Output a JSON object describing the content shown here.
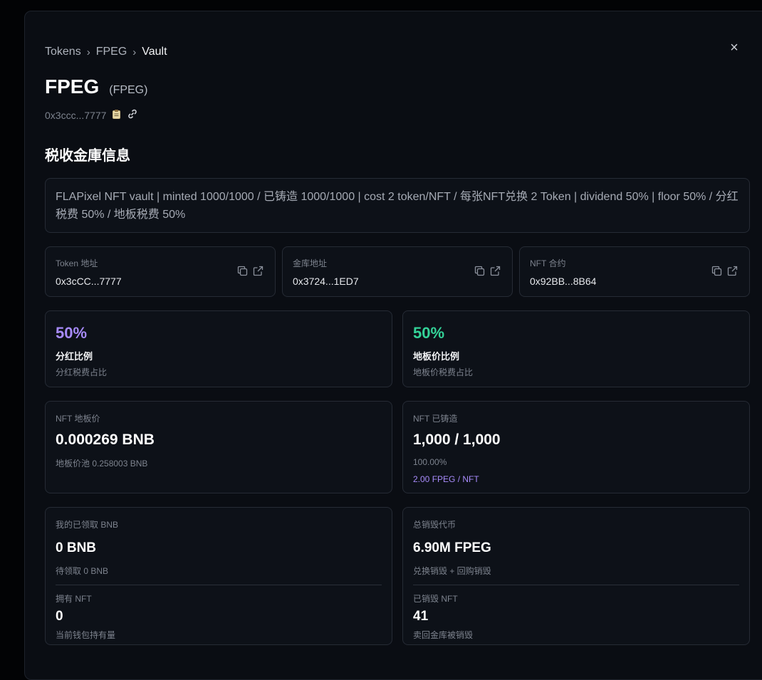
{
  "breadcrumb": [
    "Tokens",
    "FPEG",
    "Vault"
  ],
  "breadcrumb_sep": "›",
  "close_icon": "×",
  "token": {
    "name": "FPEG",
    "symbol": "(FPEG)",
    "short_address": "0x3ccc...7777"
  },
  "section_title": "税收金庫信息",
  "description": "FLAPixel NFT vault | minted 1000/1000 / 已铸造 1000/1000 | cost 2 token/NFT / 每张NFT兑换 2 Token | dividend 50% | floor 50% / 分红税费 50% / 地板税费 50%",
  "addresses": [
    {
      "label": "Token 地址",
      "value": "0x3cCC...7777"
    },
    {
      "label": "金库地址",
      "value": "0x3724...1ED7"
    },
    {
      "label": "NFT 合约",
      "value": "0x92BB...8B64"
    }
  ],
  "ratios": [
    {
      "percent": "50%",
      "title": "分红比例",
      "subtitle": "分红税费占比",
      "color": "#a78bfa"
    },
    {
      "percent": "50%",
      "title": "地板价比例",
      "subtitle": "地板价税费占比",
      "color": "#34d399"
    }
  ],
  "floor_price": {
    "label": "NFT 地板价",
    "value": "0.000269 BNB",
    "sub": "地板价池 0.258003 BNB"
  },
  "minted": {
    "label": "NFT 已铸造",
    "value": "1,000 / 1,000",
    "percent": "100.00%",
    "rate": "2.00 FPEG / NFT"
  },
  "claimed": {
    "label": "我的已领取 BNB",
    "value": "0 BNB",
    "sub": "待领取 0 BNB",
    "own_label": "拥有 NFT",
    "own_value": "0",
    "own_sub": "当前钱包持有量"
  },
  "burned": {
    "label": "总销毁代币",
    "value": "6.90M FPEG",
    "sub": "兑换销毁 + 回购销毁",
    "nft_label": "已销毁 NFT",
    "nft_value": "41",
    "nft_sub": "卖回金库被销毁"
  },
  "icons": {
    "copy": "copy-icon",
    "external": "external-link-icon",
    "clipboard": "clipboard-icon",
    "link": "link-icon"
  }
}
